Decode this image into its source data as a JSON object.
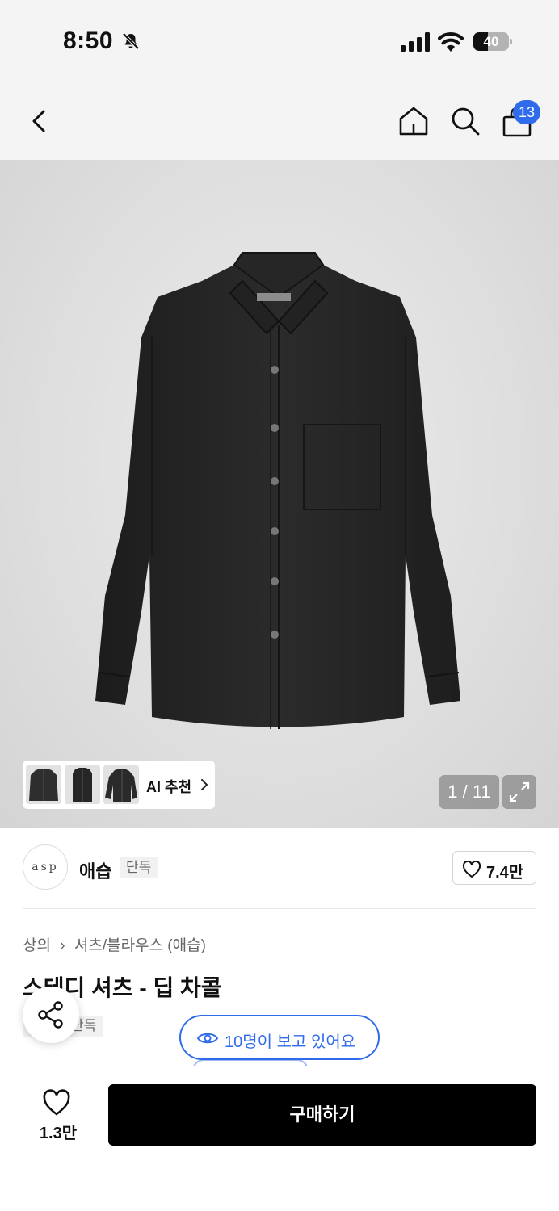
{
  "status": {
    "time": "8:50",
    "battery": "40",
    "battery_level_percent": 40
  },
  "nav": {
    "cart_count": "13",
    "icons": [
      "back-icon",
      "home-icon",
      "search-icon",
      "bag-icon"
    ]
  },
  "gallery": {
    "ai_label": "AI 추천",
    "counter": "1 / 11",
    "thumbnails": [
      "shirt-thumbnail-1",
      "shirt-thumbnail-2",
      "shirt-thumbnail-3"
    ]
  },
  "brand": {
    "logo_text": "asp",
    "name": "애습",
    "tag": "단독",
    "likes": "7.4만"
  },
  "product": {
    "breadcrumb": [
      "상의",
      "셔츠/블라우스 (애습)"
    ],
    "title": "스테디 셔츠 - 딥 차콜",
    "tag": "단독"
  },
  "viewers": {
    "text": "10명이 보고 있어요"
  },
  "bottom": {
    "wish_count": "1.3만",
    "buy_label": "구매하기"
  },
  "colors": {
    "accent_blue": "#2f6bea",
    "buy_button": "#000000",
    "nav_background": "#f4f4f4"
  }
}
